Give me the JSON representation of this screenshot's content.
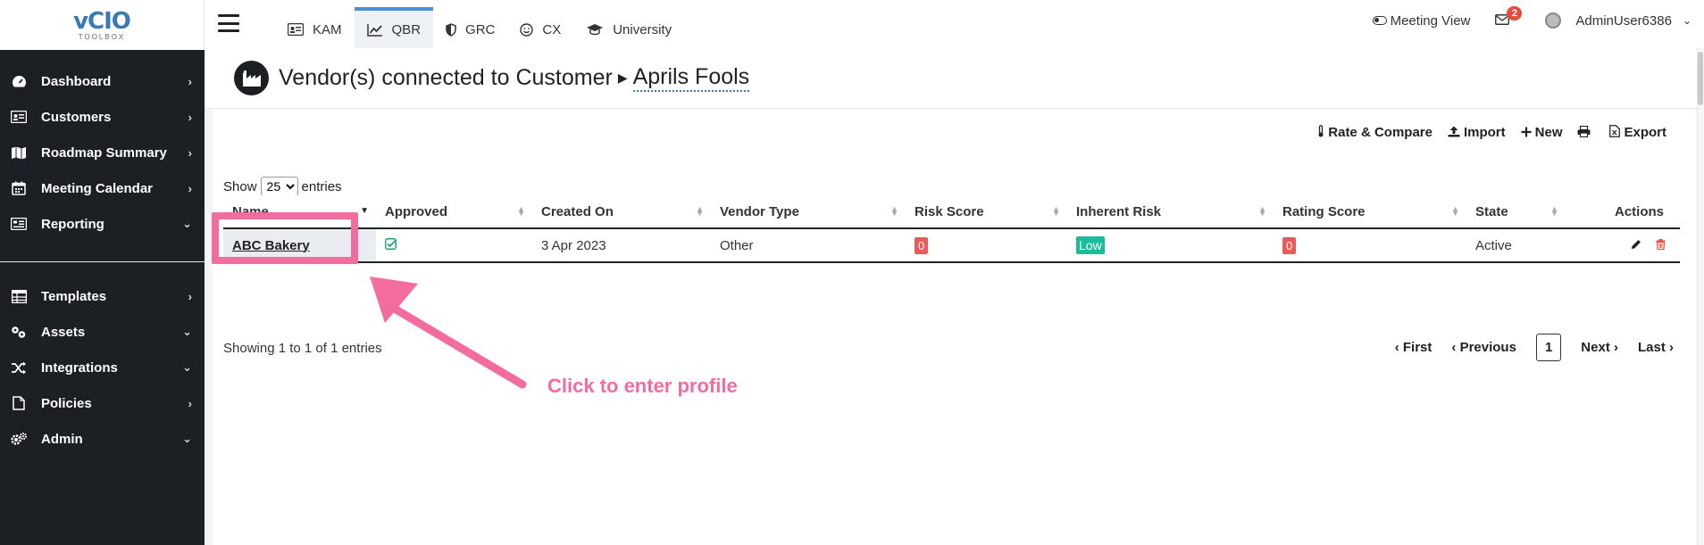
{
  "logo": {
    "main": "vCIO",
    "sub": "TOOLBOX"
  },
  "sidebar": {
    "items": [
      {
        "label": "Dashboard",
        "icon": "dashboard-icon",
        "chevron": "›"
      },
      {
        "label": "Customers",
        "icon": "customers-icon",
        "chevron": "›"
      },
      {
        "label": "Roadmap Summary",
        "icon": "map-icon",
        "chevron": "›"
      },
      {
        "label": "Meeting Calendar",
        "icon": "calendar-icon",
        "chevron": "›"
      },
      {
        "label": "Reporting",
        "icon": "reporting-icon",
        "chevron": "⌄"
      }
    ],
    "items2": [
      {
        "label": "Templates",
        "icon": "templates-icon",
        "chevron": "›"
      },
      {
        "label": "Assets",
        "icon": "assets-icon",
        "chevron": "⌄"
      },
      {
        "label": "Integrations",
        "icon": "integrations-icon",
        "chevron": "⌄"
      },
      {
        "label": "Policies",
        "icon": "policies-icon",
        "chevron": "›"
      },
      {
        "label": "Admin",
        "icon": "admin-icon",
        "chevron": "⌄"
      }
    ]
  },
  "tabs": [
    {
      "label": "KAM",
      "active": false
    },
    {
      "label": "QBR",
      "active": true
    },
    {
      "label": "GRC",
      "active": false
    },
    {
      "label": "CX",
      "active": false
    },
    {
      "label": "University",
      "active": false
    }
  ],
  "topright": {
    "meeting_view": "Meeting View",
    "mail_count": "2",
    "username": "AdminUser6386"
  },
  "header": {
    "title": "Vendor(s) connected to Customer",
    "customer": "Aprils Fools"
  },
  "toolbar": {
    "rate_compare": "Rate & Compare",
    "import": "Import",
    "new": "New",
    "export": "Export"
  },
  "show_entries": {
    "show": "Show",
    "value": "25",
    "entries": "entries"
  },
  "table": {
    "columns": [
      "Name",
      "Approved",
      "Created On",
      "Vendor Type",
      "Risk Score",
      "Inherent Risk",
      "Rating Score",
      "State",
      "Actions"
    ],
    "rows": [
      {
        "name": "ABC Bakery",
        "created_on": "3 Apr 2023",
        "vendor_type": "Other",
        "risk_score": "0",
        "inherent_risk": "Low",
        "rating_score": "0",
        "state": "Active"
      }
    ]
  },
  "info": "Showing 1 to 1 of 1 entries",
  "pager": {
    "first": "First",
    "previous": "Previous",
    "current": "1",
    "next": "Next",
    "last": "Last"
  },
  "annotation": {
    "text": "Click to enter profile",
    "color": "#f26ca0"
  },
  "colors": {
    "sidebar_bg": "#1c1f24",
    "accent": "#4a90d9",
    "danger": "#e95b5b",
    "success": "#1abc9c"
  }
}
